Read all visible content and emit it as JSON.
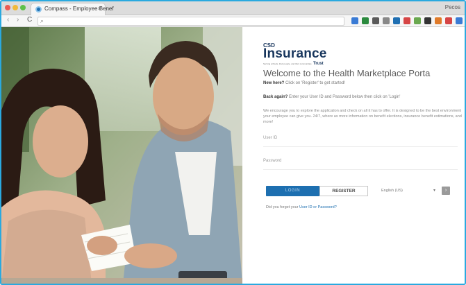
{
  "browser": {
    "tab_title": "Compass - Employee Benef",
    "tab_close": "×",
    "user_name": "Pecos",
    "nav_back": "‹",
    "nav_forward": "›",
    "nav_reload": "C",
    "omnibox_icon": "search-icon",
    "omnibox_glyph": "⌕",
    "extension_colors": [
      "#3a7bd5",
      "#2b8a3e",
      "#5a5a5a",
      "#888888",
      "#1f6fb2",
      "#d64545",
      "#6aa84f",
      "#333333",
      "#e07b2a",
      "#d64545",
      "#3a7bd5"
    ]
  },
  "logo": {
    "top": "CSD",
    "main": "Insurance",
    "trust": "Trust",
    "tagline": "Serving schools, their people, and their communities"
  },
  "panel": {
    "welcome": "Welcome to the Health Marketplace Porta",
    "new_here_lead": "New here?",
    "new_here_text": " Click on 'Register' to get started!",
    "back_again_lead": "Back again?",
    "back_again_text": " Enter your User ID and Password below then click on 'Login'",
    "info": "We encourage you to explore the application and check on all it has to offer. It is designed to be the best environment your employee can give you. 24/7, where as more information on benefit elections, insurance benefit estimations, and more!",
    "userid_label": "User ID",
    "password_label": "Password",
    "login_button": "LOGIN",
    "register_button": "REGISTER",
    "language_value": "English (US)",
    "language_arrow": "▾",
    "language_go": "›",
    "forgot_text": "Did you forget your ",
    "forgot_link": "User ID or Password?"
  },
  "colors": {
    "frame": "#2aa9df",
    "brand_navy": "#17355c",
    "login_blue": "#1d6fb0"
  }
}
